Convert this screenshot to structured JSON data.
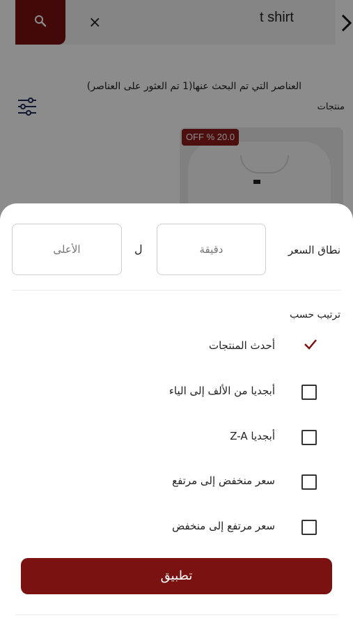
{
  "search": {
    "query": "t shirt",
    "clear_glyph": "×"
  },
  "results": {
    "summary": "العناصر التي تم البحث عنها(1 تم العثور على العناصر)",
    "products_label": "منتجات",
    "discount_badge": "OFF % 20.0"
  },
  "filter_sheet": {
    "price_label": "نطاق السعر",
    "min_placeholder": "دقيقة",
    "max_placeholder": "الأعلى",
    "to_label": "ل",
    "sort_title": "ترتيب حسب",
    "sort_options": [
      {
        "label": "أحدث المنتجات",
        "selected": true
      },
      {
        "label": "أبجديا من الألف إلى الياء",
        "selected": false
      },
      {
        "label": "أبجديا Z-A",
        "selected": false
      },
      {
        "label": "سعر منخفض إلى مرتفع",
        "selected": false
      },
      {
        "label": "سعر مرتفع إلى منخفض",
        "selected": false
      }
    ],
    "apply_label": "تطبيق"
  },
  "colors": {
    "brand": "#7a1212",
    "badge": "#8b1a1a",
    "overlay": "rgba(0,0,0,0.45)"
  },
  "icons": [
    "search-icon",
    "close-icon",
    "chevron-right-icon",
    "filter-sliders-icon",
    "check-icon"
  ]
}
